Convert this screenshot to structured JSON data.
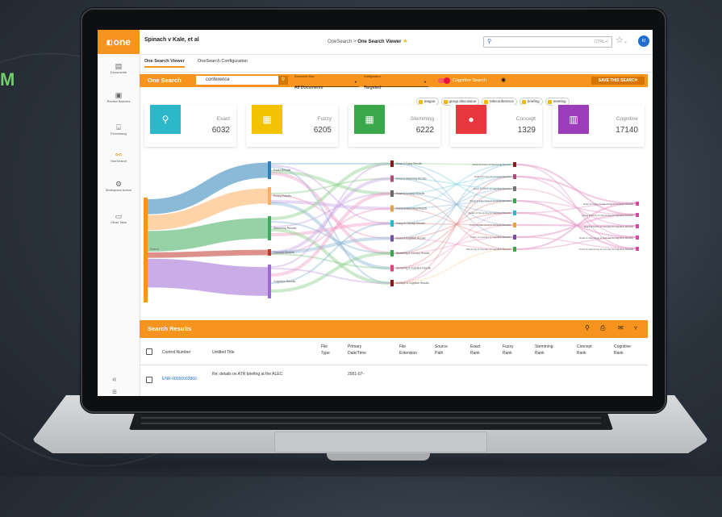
{
  "brand_fragment": "M",
  "app": {
    "logo": "one",
    "case_title": "Spinach v Kale, et al",
    "breadcrumb": {
      "root": "OneSearch",
      "sep": ">",
      "current": "One Search Viewer"
    },
    "top_search": {
      "placeholder": "",
      "shortcut": "CTRL+/"
    },
    "user_initials": "KI"
  },
  "sidebar": {
    "items": [
      {
        "label": "Documents",
        "icon": "documents-icon"
      },
      {
        "label": "Review Batches",
        "icon": "review-batches-icon"
      },
      {
        "label": "Processing",
        "icon": "processing-icon"
      },
      {
        "label": "OneSearch",
        "icon": "onesearch-icon"
      },
      {
        "label": "Workspace Admin",
        "icon": "workspace-admin-icon"
      },
      {
        "label": "Other Tabs",
        "icon": "folder-icon"
      }
    ]
  },
  "tabs": [
    "One Search Viewer",
    "OneSearch Configuration"
  ],
  "search_bar": {
    "label": "One Search",
    "query": "conference",
    "document_view_caption": "Document View",
    "document_view": "All Documents",
    "configuration_caption": "Configuration",
    "configuration": "Targeted",
    "cognitive_toggle": "Cognitive Search",
    "save_button": "SAVE THIS SEARCH"
  },
  "chips": [
    "league",
    "group discussion",
    "teleconference",
    "briefing",
    "meeting"
  ],
  "cards": [
    {
      "name": "Exact",
      "count": "6032",
      "color": "#2cb8c9",
      "icon": "search-icon"
    },
    {
      "name": "Fuzzy",
      "count": "6205",
      "color": "#f2c300",
      "icon": "fuzzy-icon"
    },
    {
      "name": "Stemming",
      "count": "6222",
      "color": "#3aa84a",
      "icon": "stemming-icon"
    },
    {
      "name": "Concept",
      "count": "1329",
      "color": "#e8383d",
      "icon": "lightbulb-icon"
    },
    {
      "name": "Cognitive",
      "count": "17140",
      "color": "#9b3dbb",
      "icon": "book-icon"
    }
  ],
  "sankey": {
    "root": "Search",
    "level1": [
      "Exact Results",
      "Fuzzy Results",
      "Stemming Results",
      "Concept Results",
      "Cognitive Results"
    ],
    "level2": [
      "Exact & Fuzzy Results",
      "Exact & Stemming Results",
      "Exact & Concept Results",
      "Fuzzy & Stemming Results",
      "Fuzzy & Concept Results",
      "Exact & Cognitive Results",
      "Stemming & Concept Results",
      "Stemming & Cognitive Results",
      "Concept & Cognitive Results"
    ],
    "level3": [
      "Exact & Fuzzy & Stemming Results",
      "Exact & Fuzzy & Concept Results",
      "Exact & Fuzzy & Cognitive Results",
      "Exact & Stemming & Concept Results",
      "Exact & Stemming & Cognitive Results",
      "Fuzzy & Stemming & Concept Results",
      "Fuzzy & Concept & Cognitive Results",
      "Stemming & Concept & Cognitive Results"
    ],
    "level4": [
      "Exact & Fuzzy & Stemming & Concept Results",
      "Exact & Fuzzy & Stemming & Cognitive Results",
      "Exact & Fuzzy & Concept & Cognitive Results",
      "Exact & Stemming & Concept & Cognitive Results",
      "Fuzzy & Stemming & Concept & Cognitive Results"
    ]
  },
  "results": {
    "title": "Search Results",
    "columns": [
      "Control Number",
      "Untitled Title",
      "File Type",
      "Primary Date/Time",
      "File Extension",
      "Source Path",
      "Exact Rank",
      "Fuzzy Rank",
      "Stemming Rank",
      "Concept Rank",
      "Cognitive Rank"
    ],
    "row1": {
      "control": "ENR-00000003860",
      "title": "Re: details on ATR briefing at the ALEC",
      "date": "2001-07-"
    }
  }
}
